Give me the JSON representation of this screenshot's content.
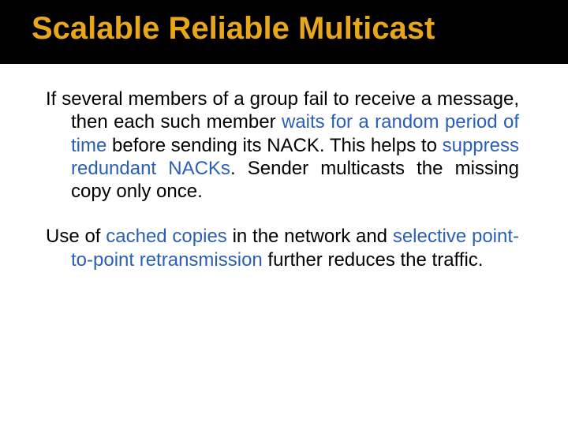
{
  "title": "Scalable Reliable Multicast",
  "p1": {
    "t1": "If several members of a group fail to receive a message, then each such member ",
    "h1": "waits for a random period of time",
    "t2": " before sending its NACK. This helps to ",
    "h2": "suppress redundant NACKs",
    "t3": ". Sender multicasts the missing copy only once."
  },
  "p2": {
    "t1": "Use of ",
    "h1": "cached copies",
    "t2": " in the network and ",
    "h2": "selective point-to-point retransmission",
    "t3": " further reduces the traffic."
  }
}
